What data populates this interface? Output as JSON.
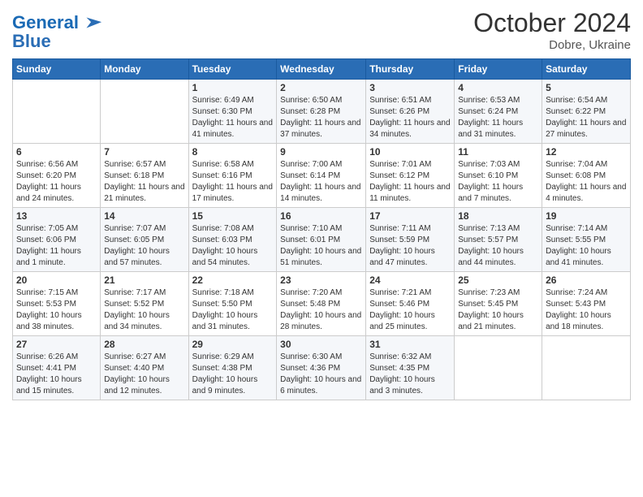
{
  "logo": {
    "line1": "General",
    "line2": "Blue"
  },
  "header": {
    "month": "October 2024",
    "location": "Dobre, Ukraine"
  },
  "weekdays": [
    "Sunday",
    "Monday",
    "Tuesday",
    "Wednesday",
    "Thursday",
    "Friday",
    "Saturday"
  ],
  "weeks": [
    [
      {
        "day": "",
        "sunrise": "",
        "sunset": "",
        "daylight": ""
      },
      {
        "day": "",
        "sunrise": "",
        "sunset": "",
        "daylight": ""
      },
      {
        "day": "1",
        "sunrise": "Sunrise: 6:49 AM",
        "sunset": "Sunset: 6:30 PM",
        "daylight": "Daylight: 11 hours and 41 minutes."
      },
      {
        "day": "2",
        "sunrise": "Sunrise: 6:50 AM",
        "sunset": "Sunset: 6:28 PM",
        "daylight": "Daylight: 11 hours and 37 minutes."
      },
      {
        "day": "3",
        "sunrise": "Sunrise: 6:51 AM",
        "sunset": "Sunset: 6:26 PM",
        "daylight": "Daylight: 11 hours and 34 minutes."
      },
      {
        "day": "4",
        "sunrise": "Sunrise: 6:53 AM",
        "sunset": "Sunset: 6:24 PM",
        "daylight": "Daylight: 11 hours and 31 minutes."
      },
      {
        "day": "5",
        "sunrise": "Sunrise: 6:54 AM",
        "sunset": "Sunset: 6:22 PM",
        "daylight": "Daylight: 11 hours and 27 minutes."
      }
    ],
    [
      {
        "day": "6",
        "sunrise": "Sunrise: 6:56 AM",
        "sunset": "Sunset: 6:20 PM",
        "daylight": "Daylight: 11 hours and 24 minutes."
      },
      {
        "day": "7",
        "sunrise": "Sunrise: 6:57 AM",
        "sunset": "Sunset: 6:18 PM",
        "daylight": "Daylight: 11 hours and 21 minutes."
      },
      {
        "day": "8",
        "sunrise": "Sunrise: 6:58 AM",
        "sunset": "Sunset: 6:16 PM",
        "daylight": "Daylight: 11 hours and 17 minutes."
      },
      {
        "day": "9",
        "sunrise": "Sunrise: 7:00 AM",
        "sunset": "Sunset: 6:14 PM",
        "daylight": "Daylight: 11 hours and 14 minutes."
      },
      {
        "day": "10",
        "sunrise": "Sunrise: 7:01 AM",
        "sunset": "Sunset: 6:12 PM",
        "daylight": "Daylight: 11 hours and 11 minutes."
      },
      {
        "day": "11",
        "sunrise": "Sunrise: 7:03 AM",
        "sunset": "Sunset: 6:10 PM",
        "daylight": "Daylight: 11 hours and 7 minutes."
      },
      {
        "day": "12",
        "sunrise": "Sunrise: 7:04 AM",
        "sunset": "Sunset: 6:08 PM",
        "daylight": "Daylight: 11 hours and 4 minutes."
      }
    ],
    [
      {
        "day": "13",
        "sunrise": "Sunrise: 7:05 AM",
        "sunset": "Sunset: 6:06 PM",
        "daylight": "Daylight: 11 hours and 1 minute."
      },
      {
        "day": "14",
        "sunrise": "Sunrise: 7:07 AM",
        "sunset": "Sunset: 6:05 PM",
        "daylight": "Daylight: 10 hours and 57 minutes."
      },
      {
        "day": "15",
        "sunrise": "Sunrise: 7:08 AM",
        "sunset": "Sunset: 6:03 PM",
        "daylight": "Daylight: 10 hours and 54 minutes."
      },
      {
        "day": "16",
        "sunrise": "Sunrise: 7:10 AM",
        "sunset": "Sunset: 6:01 PM",
        "daylight": "Daylight: 10 hours and 51 minutes."
      },
      {
        "day": "17",
        "sunrise": "Sunrise: 7:11 AM",
        "sunset": "Sunset: 5:59 PM",
        "daylight": "Daylight: 10 hours and 47 minutes."
      },
      {
        "day": "18",
        "sunrise": "Sunrise: 7:13 AM",
        "sunset": "Sunset: 5:57 PM",
        "daylight": "Daylight: 10 hours and 44 minutes."
      },
      {
        "day": "19",
        "sunrise": "Sunrise: 7:14 AM",
        "sunset": "Sunset: 5:55 PM",
        "daylight": "Daylight: 10 hours and 41 minutes."
      }
    ],
    [
      {
        "day": "20",
        "sunrise": "Sunrise: 7:15 AM",
        "sunset": "Sunset: 5:53 PM",
        "daylight": "Daylight: 10 hours and 38 minutes."
      },
      {
        "day": "21",
        "sunrise": "Sunrise: 7:17 AM",
        "sunset": "Sunset: 5:52 PM",
        "daylight": "Daylight: 10 hours and 34 minutes."
      },
      {
        "day": "22",
        "sunrise": "Sunrise: 7:18 AM",
        "sunset": "Sunset: 5:50 PM",
        "daylight": "Daylight: 10 hours and 31 minutes."
      },
      {
        "day": "23",
        "sunrise": "Sunrise: 7:20 AM",
        "sunset": "Sunset: 5:48 PM",
        "daylight": "Daylight: 10 hours and 28 minutes."
      },
      {
        "day": "24",
        "sunrise": "Sunrise: 7:21 AM",
        "sunset": "Sunset: 5:46 PM",
        "daylight": "Daylight: 10 hours and 25 minutes."
      },
      {
        "day": "25",
        "sunrise": "Sunrise: 7:23 AM",
        "sunset": "Sunset: 5:45 PM",
        "daylight": "Daylight: 10 hours and 21 minutes."
      },
      {
        "day": "26",
        "sunrise": "Sunrise: 7:24 AM",
        "sunset": "Sunset: 5:43 PM",
        "daylight": "Daylight: 10 hours and 18 minutes."
      }
    ],
    [
      {
        "day": "27",
        "sunrise": "Sunrise: 6:26 AM",
        "sunset": "Sunset: 4:41 PM",
        "daylight": "Daylight: 10 hours and 15 minutes."
      },
      {
        "day": "28",
        "sunrise": "Sunrise: 6:27 AM",
        "sunset": "Sunset: 4:40 PM",
        "daylight": "Daylight: 10 hours and 12 minutes."
      },
      {
        "day": "29",
        "sunrise": "Sunrise: 6:29 AM",
        "sunset": "Sunset: 4:38 PM",
        "daylight": "Daylight: 10 hours and 9 minutes."
      },
      {
        "day": "30",
        "sunrise": "Sunrise: 6:30 AM",
        "sunset": "Sunset: 4:36 PM",
        "daylight": "Daylight: 10 hours and 6 minutes."
      },
      {
        "day": "31",
        "sunrise": "Sunrise: 6:32 AM",
        "sunset": "Sunset: 4:35 PM",
        "daylight": "Daylight: 10 hours and 3 minutes."
      },
      {
        "day": "",
        "sunrise": "",
        "sunset": "",
        "daylight": ""
      },
      {
        "day": "",
        "sunrise": "",
        "sunset": "",
        "daylight": ""
      }
    ]
  ]
}
